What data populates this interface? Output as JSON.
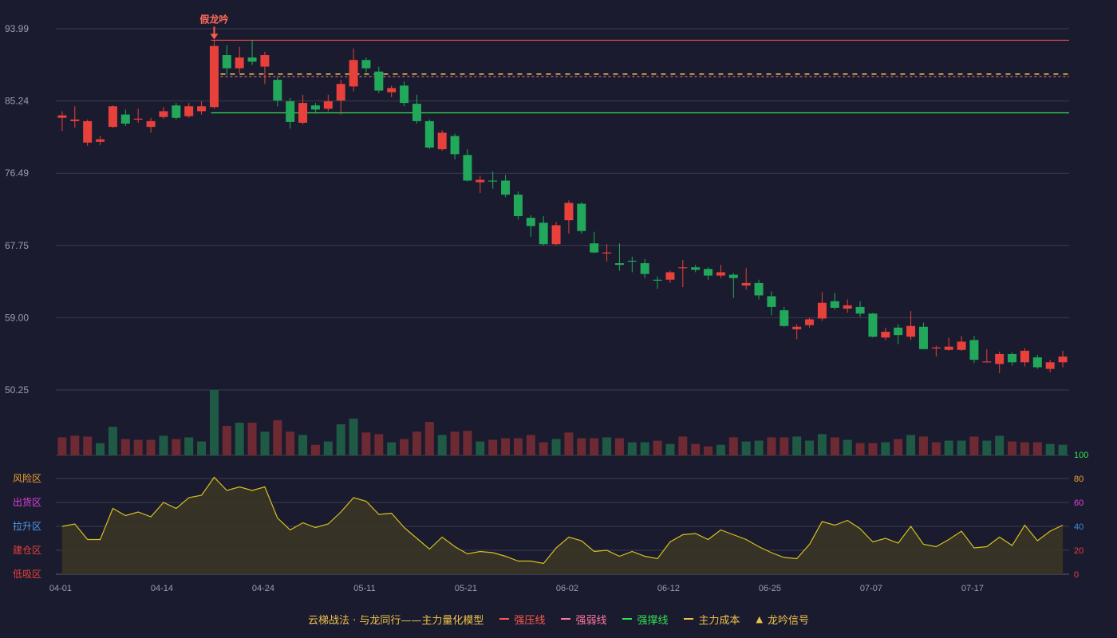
{
  "chart_data": {
    "type": "candlestick",
    "price_axis": {
      "ticks": [
        "93.99",
        "85.24",
        "76.49",
        "67.75",
        "59.00",
        "50.25"
      ],
      "range": [
        50.25,
        93.99
      ]
    },
    "x_ticks": [
      {
        "i": 0,
        "label": "04-01"
      },
      {
        "i": 8,
        "label": "04-14"
      },
      {
        "i": 16,
        "label": "04-24"
      },
      {
        "i": 24,
        "label": "05-11"
      },
      {
        "i": 32,
        "label": "05-21"
      },
      {
        "i": 40,
        "label": "06-02"
      },
      {
        "i": 48,
        "label": "06-12"
      },
      {
        "i": 56,
        "label": "06-25"
      },
      {
        "i": 64,
        "label": "07-07"
      },
      {
        "i": 72,
        "label": "07-17"
      }
    ],
    "candles": [
      [
        83.2,
        83.5,
        81.6,
        84.0
      ],
      [
        82.8,
        83.0,
        82.0,
        84.6
      ],
      [
        80.2,
        82.8,
        79.8,
        83.0
      ],
      [
        80.3,
        80.6,
        79.9,
        81.0
      ],
      [
        82.1,
        84.6,
        82.0,
        84.7
      ],
      [
        83.6,
        82.5,
        82.2,
        84.2
      ],
      [
        83.0,
        83.1,
        82.6,
        84.3
      ],
      [
        82.1,
        82.8,
        81.4,
        83.2
      ],
      [
        83.3,
        84.0,
        83.1,
        84.5
      ],
      [
        84.7,
        83.2,
        83.0,
        85.0
      ],
      [
        83.4,
        84.6,
        83.2,
        85.0
      ],
      [
        84.0,
        84.6,
        83.6,
        85.2
      ],
      [
        84.5,
        91.9,
        84.3,
        92.6
      ],
      [
        90.8,
        89.2,
        88.4,
        92.0
      ],
      [
        89.2,
        90.5,
        88.6,
        91.8
      ],
      [
        90.5,
        90.0,
        89.6,
        92.6
      ],
      [
        89.4,
        90.8,
        87.3,
        91.2
      ],
      [
        87.8,
        85.3,
        84.6,
        88.2
      ],
      [
        85.2,
        82.7,
        81.9,
        85.6
      ],
      [
        82.6,
        85.0,
        82.4,
        86.0
      ],
      [
        84.7,
        84.2,
        83.9,
        85.0
      ],
      [
        84.3,
        85.2,
        84.0,
        86.0
      ],
      [
        85.3,
        87.3,
        83.6,
        87.8
      ],
      [
        87.0,
        90.2,
        86.4,
        91.6
      ],
      [
        90.2,
        89.2,
        88.7,
        90.5
      ],
      [
        88.8,
        86.5,
        86.2,
        89.4
      ],
      [
        86.3,
        86.8,
        85.7,
        87.1
      ],
      [
        87.1,
        85.0,
        84.6,
        87.6
      ],
      [
        84.9,
        82.8,
        82.5,
        86.0
      ],
      [
        82.8,
        79.6,
        79.4,
        83.0
      ],
      [
        79.4,
        81.4,
        79.2,
        81.7
      ],
      [
        81.0,
        78.8,
        78.2,
        81.3
      ],
      [
        78.7,
        75.6,
        75.5,
        79.4
      ],
      [
        75.4,
        75.7,
        74.1,
        76.2
      ],
      [
        75.6,
        75.5,
        74.6,
        76.7
      ],
      [
        75.6,
        73.9,
        73.6,
        76.3
      ],
      [
        73.9,
        71.3,
        70.9,
        74.3
      ],
      [
        71.1,
        70.1,
        68.8,
        71.4
      ],
      [
        70.5,
        67.9,
        67.7,
        71.3
      ],
      [
        67.9,
        70.2,
        67.8,
        70.6
      ],
      [
        70.8,
        72.9,
        69.2,
        73.2
      ],
      [
        72.8,
        69.5,
        69.2,
        73.0
      ],
      [
        68.0,
        66.9,
        66.8,
        69.4
      ],
      [
        66.8,
        66.9,
        65.8,
        67.9
      ],
      [
        65.6,
        65.4,
        64.7,
        68.0
      ],
      [
        65.9,
        65.8,
        64.5,
        66.4
      ],
      [
        65.6,
        64.3,
        63.8,
        66.1
      ],
      [
        63.6,
        63.5,
        62.5,
        64.0
      ],
      [
        63.6,
        64.5,
        63.2,
        64.7
      ],
      [
        65.0,
        65.1,
        62.7,
        66.0
      ],
      [
        65.1,
        64.8,
        64.5,
        65.4
      ],
      [
        64.9,
        64.1,
        63.6,
        65.1
      ],
      [
        64.1,
        64.5,
        63.8,
        65.4
      ],
      [
        64.2,
        63.8,
        61.4,
        64.4
      ],
      [
        62.9,
        63.2,
        62.4,
        65.0
      ],
      [
        63.2,
        61.7,
        61.2,
        63.6
      ],
      [
        61.6,
        60.3,
        59.3,
        62.2
      ],
      [
        59.9,
        58.0,
        57.9,
        60.3
      ],
      [
        57.6,
        57.9,
        56.4,
        58.2
      ],
      [
        58.1,
        58.8,
        57.8,
        59.0
      ],
      [
        58.9,
        60.8,
        58.6,
        62.1
      ],
      [
        61.0,
        60.2,
        60.0,
        62.0
      ],
      [
        60.1,
        60.5,
        59.6,
        61.2
      ],
      [
        60.3,
        59.5,
        59.1,
        61.0
      ],
      [
        59.5,
        56.7,
        56.6,
        59.6
      ],
      [
        56.6,
        57.3,
        56.3,
        57.8
      ],
      [
        57.8,
        56.9,
        55.8,
        58.2
      ],
      [
        56.7,
        58.0,
        56.3,
        59.8
      ],
      [
        57.9,
        55.2,
        55.2,
        58.4
      ],
      [
        55.3,
        55.4,
        54.3,
        55.6
      ],
      [
        55.1,
        55.5,
        55.0,
        56.6
      ],
      [
        55.1,
        56.1,
        55.0,
        56.8
      ],
      [
        56.3,
        53.9,
        53.5,
        56.8
      ],
      [
        53.7,
        53.7,
        53.6,
        55.2
      ],
      [
        53.4,
        54.6,
        52.3,
        54.9
      ],
      [
        54.6,
        53.6,
        53.2,
        54.8
      ],
      [
        53.6,
        55.0,
        53.1,
        55.3
      ],
      [
        54.2,
        53.0,
        52.8,
        54.5
      ],
      [
        52.8,
        53.6,
        52.4,
        53.9
      ],
      [
        53.6,
        54.3,
        53.0,
        55.0
      ]
    ],
    "volume": [
      [
        22,
        "r"
      ],
      [
        24,
        "r"
      ],
      [
        23,
        "r"
      ],
      [
        15,
        "g"
      ],
      [
        35,
        "g"
      ],
      [
        20,
        "r"
      ],
      [
        19,
        "r"
      ],
      [
        19,
        "r"
      ],
      [
        24,
        "g"
      ],
      [
        20,
        "r"
      ],
      [
        22,
        "g"
      ],
      [
        17,
        "g"
      ],
      [
        80,
        "g"
      ],
      [
        36,
        "r"
      ],
      [
        40,
        "g"
      ],
      [
        40,
        "r"
      ],
      [
        29,
        "g"
      ],
      [
        43,
        "r"
      ],
      [
        29,
        "r"
      ],
      [
        25,
        "g"
      ],
      [
        13,
        "r"
      ],
      [
        17,
        "g"
      ],
      [
        38,
        "g"
      ],
      [
        45,
        "g"
      ],
      [
        28,
        "r"
      ],
      [
        26,
        "r"
      ],
      [
        16,
        "g"
      ],
      [
        20,
        "r"
      ],
      [
        29,
        "r"
      ],
      [
        41,
        "r"
      ],
      [
        25,
        "g"
      ],
      [
        29,
        "r"
      ],
      [
        30,
        "r"
      ],
      [
        17,
        "g"
      ],
      [
        19,
        "r"
      ],
      [
        21,
        "r"
      ],
      [
        21,
        "r"
      ],
      [
        25,
        "r"
      ],
      [
        16,
        "r"
      ],
      [
        20,
        "g"
      ],
      [
        28,
        "r"
      ],
      [
        21,
        "r"
      ],
      [
        21,
        "r"
      ],
      [
        22,
        "g"
      ],
      [
        21,
        "r"
      ],
      [
        16,
        "g"
      ],
      [
        16,
        "g"
      ],
      [
        18,
        "r"
      ],
      [
        14,
        "g"
      ],
      [
        23,
        "r"
      ],
      [
        14,
        "r"
      ],
      [
        11,
        "r"
      ],
      [
        13,
        "g"
      ],
      [
        22,
        "r"
      ],
      [
        17,
        "g"
      ],
      [
        18,
        "g"
      ],
      [
        22,
        "r"
      ],
      [
        22,
        "r"
      ],
      [
        23,
        "g"
      ],
      [
        18,
        "g"
      ],
      [
        26,
        "g"
      ],
      [
        22,
        "r"
      ],
      [
        19,
        "g"
      ],
      [
        15,
        "r"
      ],
      [
        15,
        "r"
      ],
      [
        16,
        "g"
      ],
      [
        20,
        "r"
      ],
      [
        25,
        "g"
      ],
      [
        23,
        "r"
      ],
      [
        16,
        "r"
      ],
      [
        18,
        "g"
      ],
      [
        18,
        "g"
      ],
      [
        23,
        "r"
      ],
      [
        18,
        "g"
      ],
      [
        24,
        "g"
      ],
      [
        17,
        "r"
      ],
      [
        16,
        "r"
      ],
      [
        16,
        "r"
      ],
      [
        14,
        "g"
      ],
      [
        13,
        "g"
      ]
    ],
    "indicator": {
      "axis_ticks": [
        0,
        20,
        40,
        60,
        80,
        100
      ],
      "axis_tick_colors": [
        "#e8413c",
        "#e8413c",
        "#3b8de0",
        "#e040e0",
        "#f0a030",
        "#34e050"
      ],
      "zones": [
        {
          "label": "风险区",
          "color": "#f0a030"
        },
        {
          "label": "出货区",
          "color": "#e040e0"
        },
        {
          "label": "拉升区",
          "color": "#4f9cf0"
        },
        {
          "label": "建仓区",
          "color": "#e8413c"
        },
        {
          "label": "低吸区",
          "color": "#e8413c"
        }
      ],
      "values": [
        40,
        42,
        29,
        29,
        55,
        49,
        52,
        48,
        60,
        55,
        64,
        66,
        81,
        70,
        73,
        70,
        73,
        47,
        37,
        43,
        39,
        42,
        52,
        64,
        61,
        50,
        51,
        39,
        30,
        21,
        31,
        23,
        17,
        19,
        18,
        15,
        11,
        11,
        9,
        22,
        31,
        28,
        19,
        20,
        15,
        19,
        15,
        13,
        27,
        33,
        34,
        29,
        37,
        33,
        29,
        23,
        18,
        14,
        13,
        25,
        44,
        41,
        45,
        38,
        27,
        30,
        26,
        40,
        25,
        23,
        29,
        36,
        22,
        23,
        31,
        24,
        41,
        28,
        36,
        41
      ]
    },
    "levels": {
      "resistance": 92.6,
      "weak": 88.2,
      "cost": 88.5,
      "support": 83.8
    },
    "signal": {
      "index": 12,
      "label": "假龙吟"
    }
  },
  "legend": {
    "title": "云梯战法 · 与龙同行——主力量化模型",
    "items": [
      {
        "label": "强压线",
        "color": "#ff5a4e"
      },
      {
        "label": "强弱线",
        "color": "#ff7aa0"
      },
      {
        "label": "强撑线",
        "color": "#34e050"
      },
      {
        "label": "主力成本",
        "color": "#f0c24a"
      },
      {
        "label": "龙吟信号",
        "color": "#f0c24a"
      }
    ]
  },
  "colors": {
    "up": "#e8413c",
    "down": "#22a85a",
    "grid": "#3a3c52",
    "axis_text": "#9a9cb0",
    "indicator_line": "#d8c020",
    "indicator_fill": "#3a3526"
  }
}
